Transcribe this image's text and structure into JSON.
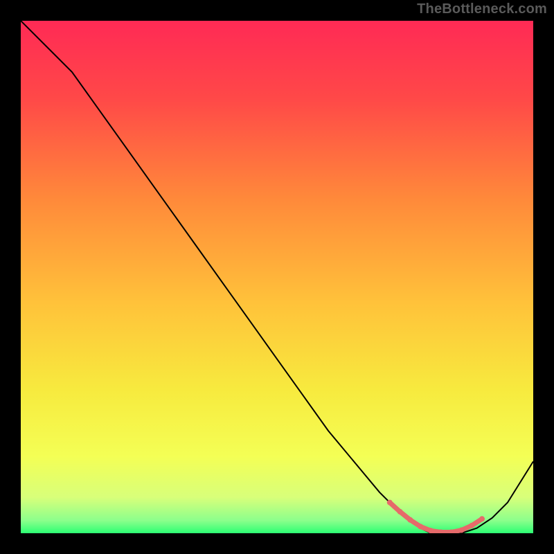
{
  "watermark": "TheBottleneck.com",
  "chart_data": {
    "type": "line",
    "title": "",
    "xlabel": "",
    "ylabel": "",
    "xlim": [
      0,
      100
    ],
    "ylim": [
      0,
      100
    ],
    "series": [
      {
        "name": "curve",
        "color": "#000000",
        "stroke_width": 2,
        "x": [
          0,
          5,
          10,
          15,
          20,
          25,
          30,
          35,
          40,
          45,
          50,
          55,
          60,
          65,
          70,
          72,
          75,
          78,
          80,
          83,
          86,
          89,
          92,
          95,
          100
        ],
        "y": [
          100,
          95,
          90,
          83,
          76,
          69,
          62,
          55,
          48,
          41,
          34,
          27,
          20,
          14,
          8,
          6,
          3,
          1,
          0,
          0,
          0,
          1,
          3,
          6,
          14
        ]
      },
      {
        "name": "highlight",
        "color": "#e66a6a",
        "stroke_width": 7,
        "stroke_linecap": "round",
        "x": [
          72,
          74,
          76,
          78,
          80,
          82,
          84,
          86,
          88,
          90
        ],
        "y": [
          6,
          4.2,
          2.6,
          1.3,
          0.5,
          0.2,
          0.2,
          0.6,
          1.5,
          2.8
        ]
      }
    ],
    "background_gradient": {
      "stops": [
        {
          "offset": 0.0,
          "color": "#ff2a55"
        },
        {
          "offset": 0.15,
          "color": "#ff4848"
        },
        {
          "offset": 0.35,
          "color": "#ff8a3a"
        },
        {
          "offset": 0.55,
          "color": "#ffc23a"
        },
        {
          "offset": 0.72,
          "color": "#f7ea3e"
        },
        {
          "offset": 0.85,
          "color": "#f4ff55"
        },
        {
          "offset": 0.93,
          "color": "#d8ff7a"
        },
        {
          "offset": 0.975,
          "color": "#8cff8c"
        },
        {
          "offset": 1.0,
          "color": "#2cff73"
        }
      ]
    }
  }
}
